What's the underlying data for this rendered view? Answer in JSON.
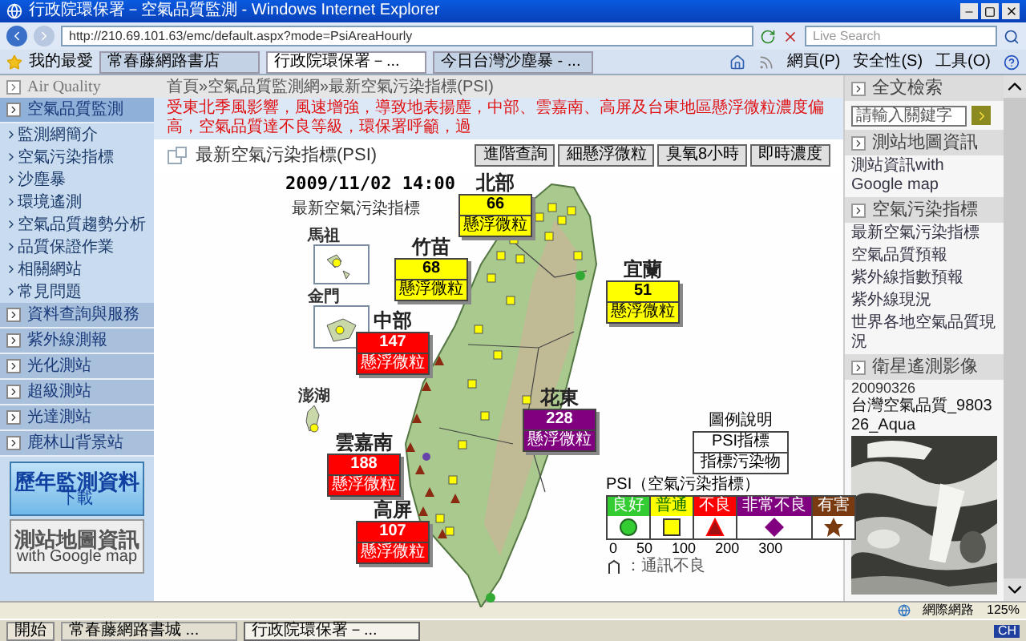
{
  "browser": {
    "title": "行政院環保署－空氣品質監測 - Windows Internet Explorer",
    "address": "http://210.69.101.63/emc/default.aspx?mode=PsiAreaHourly",
    "search_placeholder": "Live Search",
    "favorites": "我的最愛",
    "tabs": [
      {
        "label": "常春藤網路書店",
        "selected": false
      },
      {
        "label": "行政院環保署－...",
        "selected": true
      },
      {
        "label": "今日台灣沙塵暴 - ...",
        "selected": false
      }
    ],
    "menus": [
      "網頁(P)",
      "安全性(S)",
      "工具(O)"
    ],
    "status": "網際網路",
    "zoom": "125%"
  },
  "sidebar": {
    "header": "Air Quality",
    "sections": [
      {
        "label": "空氣品質監測",
        "expanded": true,
        "children": [
          "監測網簡介",
          "空氣污染指標",
          "沙塵暴",
          "環境遙測",
          "空氣品質趨勢分析",
          "品質保證作業",
          "相關網站",
          "常見問題"
        ]
      },
      {
        "label": "資料查詢與服務",
        "expanded": false
      },
      {
        "label": "紫外線測報",
        "expanded": false
      },
      {
        "label": "光化測站",
        "expanded": false
      },
      {
        "label": "超級測站",
        "expanded": false
      },
      {
        "label": "光達測站",
        "expanded": false
      },
      {
        "label": "鹿林山背景站",
        "expanded": false
      }
    ],
    "banners": [
      {
        "title": "歷年監測資料",
        "subtitle": "下載"
      },
      {
        "title": "測站地圖資訊",
        "subtitle": "with Google map"
      }
    ]
  },
  "breadcrumb": "首頁»空氣品質監測網»最新空氣污染指標(PSI)",
  "notice": "受東北季風影響，風速增強，導致地表揚塵，中部、雲嘉南、高屏及台東地區懸浮微粒濃度偏高，空氣品質達不良等級，環保署呼籲，過",
  "page_title": "最新空氣污染指標(PSI)",
  "buttons": [
    "進階查詢",
    "細懸浮微粒",
    "臭氧8小時",
    "即時濃度"
  ],
  "map": {
    "timestamp": "2009/11/02 14:00",
    "subtitle": "最新空氣污染指標",
    "islands": [
      "馬祖",
      "金門",
      "澎湖"
    ],
    "regions": [
      {
        "name": "北部",
        "value": "66",
        "pollutant": "懸浮微粒",
        "color": "#ffff00"
      },
      {
        "name": "竹苗",
        "value": "68",
        "pollutant": "懸浮微粒",
        "color": "#ffff00"
      },
      {
        "name": "宜蘭",
        "value": "51",
        "pollutant": "懸浮微粒",
        "color": "#ffff00"
      },
      {
        "name": "中部",
        "value": "147",
        "pollutant": "懸浮微粒",
        "color": "#ff0000"
      },
      {
        "name": "花東",
        "value": "228",
        "pollutant": "懸浮微粒",
        "color": "#800080"
      },
      {
        "name": "雲嘉南",
        "value": "188",
        "pollutant": "懸浮微粒",
        "color": "#ff0000"
      },
      {
        "name": "高屏",
        "value": "107",
        "pollutant": "懸浮微粒",
        "color": "#ff0000"
      }
    ],
    "legend": {
      "title": "圖例說明",
      "rows": [
        "PSI指標",
        "指標污染物"
      ],
      "psi_title": "PSI（空氣污染指標）",
      "categories": [
        {
          "label": "良好",
          "color": "#33cc33",
          "kind": "circle"
        },
        {
          "label": "普通",
          "color": "#ffff00",
          "kind": "square"
        },
        {
          "label": "不良",
          "color": "#ff0000",
          "kind": "triangle"
        },
        {
          "label": "非常不良",
          "color": "#800080",
          "kind": "diamond"
        },
        {
          "label": "有害",
          "color": "#7a3a10",
          "kind": "star"
        }
      ],
      "scale": [
        "0",
        "50",
        "100",
        "200",
        "300"
      ],
      "note": "：通訊不良"
    }
  },
  "right_panel": {
    "search": {
      "title": "全文檢索",
      "placeholder": "請輸入關鍵字"
    },
    "sections": [
      {
        "title": "測站地圖資訊",
        "links": [
          "測站資訊with Google map"
        ]
      },
      {
        "title": "空氣污染指標",
        "links": [
          "最新空氣污染指標",
          "空氣品質預報",
          "紫外線指數預報",
          "紫外線現況",
          "世界各地空氣品質現況"
        ]
      }
    ],
    "satellite": {
      "title": "衛星遙測影像",
      "date": "20090326",
      "caption": "台灣空氣品質_980326_Aqua"
    }
  },
  "taskbar": {
    "start": "開始",
    "items": [
      {
        "label": "常春藤網路書城 ...",
        "selected": false
      },
      {
        "label": "行政院環保署－...",
        "selected": true
      }
    ],
    "lang": "CH"
  }
}
